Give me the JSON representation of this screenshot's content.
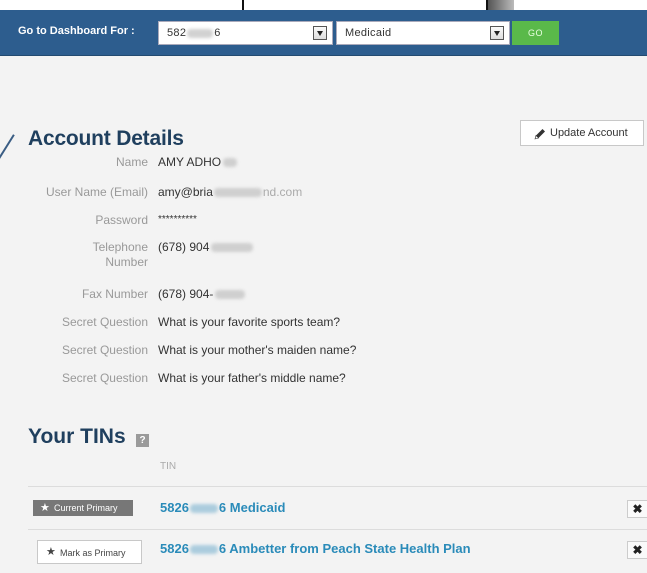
{
  "dashboard": {
    "label": "Go to Dashboard For :",
    "tin_value": "582",
    "tin_value_tail": "6",
    "plan_value": "Medicaid",
    "go_label": "GO"
  },
  "account": {
    "title": "Account Details",
    "update_label": "Update Account",
    "fields": {
      "name_label": "Name",
      "name_value": "AMY ADHO",
      "username_label": "User Name (Email)",
      "username_value": "amy@bria",
      "username_tail": "nd.com",
      "password_label": "Password",
      "password_value": "**********",
      "phone_label_1": "Telephone",
      "phone_label_2": "Number",
      "phone_value": "(678) 904",
      "fax_label": "Fax Number",
      "fax_value": "(678) 904-",
      "sq1_label": "Secret Question",
      "sq1_value": "What is your favorite sports team?",
      "sq2_label": "Secret Question",
      "sq2_value": "What is your mother's maiden name?",
      "sq3_label": "Secret Question",
      "sq3_value": "What is your father's middle name?"
    }
  },
  "tins": {
    "title": "Your TINs",
    "help_label": "?",
    "column_header": "TIN",
    "rows": [
      {
        "button_label": "Current Primary",
        "tin_prefix": "5826",
        "tin_suffix": "6",
        "plan": "Medicaid"
      },
      {
        "button_label": "Mark as Primary",
        "tin_prefix": "5826",
        "tin_suffix": "6",
        "plan": "Ambetter from Peach State Health Plan"
      }
    ],
    "delete_label": "✖"
  },
  "icons": {
    "star": "★",
    "pencil": "pencil-icon",
    "dropdown": "chevron-down-icon"
  },
  "colors": {
    "header_bg": "#2d5d8e",
    "go_green": "#5ab94a",
    "heading": "#1f3f5e",
    "link": "#2a8bb9"
  }
}
